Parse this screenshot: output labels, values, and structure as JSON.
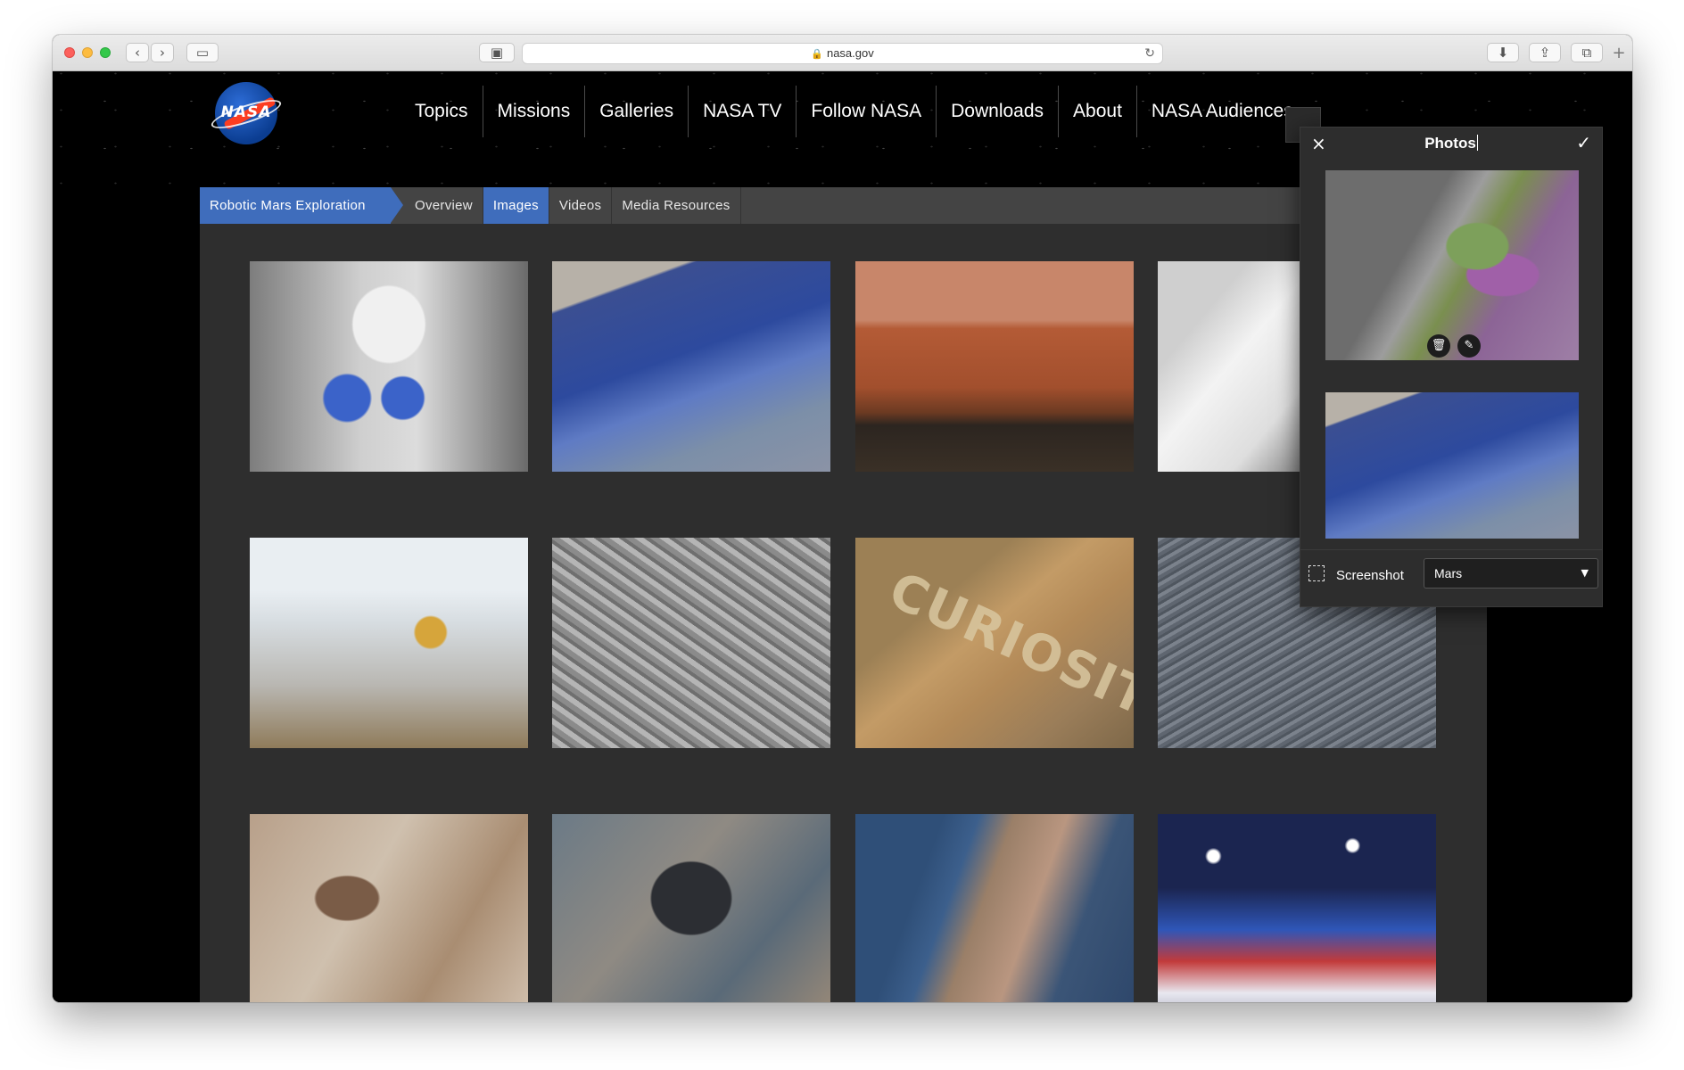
{
  "browser": {
    "url": "nasa.gov",
    "back_icon": "‹",
    "forward_icon": "›"
  },
  "site": {
    "logo_text": "NASA",
    "nav": [
      "Topics",
      "Missions",
      "Galleries",
      "NASA TV",
      "Follow NASA",
      "Downloads",
      "About",
      "NASA Audiences"
    ]
  },
  "subnav": {
    "crumb": "Robotic Mars Exploration",
    "tabs": [
      "Overview",
      "Images",
      "Videos",
      "Media Resources"
    ],
    "active_tab": "Images"
  },
  "gallery": {
    "images": [
      {
        "name": "cleanroom-spacecraft"
      },
      {
        "name": "blue-crater-rim"
      },
      {
        "name": "mars-surface-solar-panel"
      },
      {
        "name": "lander-hardware"
      },
      {
        "name": "rover-assembly"
      },
      {
        "name": "dune-field"
      },
      {
        "name": "curiosity-wheel-rock",
        "text": "CURIOSITY"
      },
      {
        "name": "dust-devil-tracks"
      },
      {
        "name": "eroded-terrain"
      },
      {
        "name": "dark-dunes"
      },
      {
        "name": "blue-channel"
      },
      {
        "name": "nasdaq-event"
      }
    ]
  },
  "panel": {
    "title": "Photos",
    "close_icon": "×",
    "confirm_icon": "✓",
    "trash_icon": "🗑",
    "edit_icon": "✎",
    "screenshot_label": "Screenshot",
    "album_value": "Mars"
  },
  "colors": {
    "accent_blue": "#3f6dbc",
    "page_bg": "#2e2e2e",
    "panel_bg": "#2d2d2d"
  }
}
